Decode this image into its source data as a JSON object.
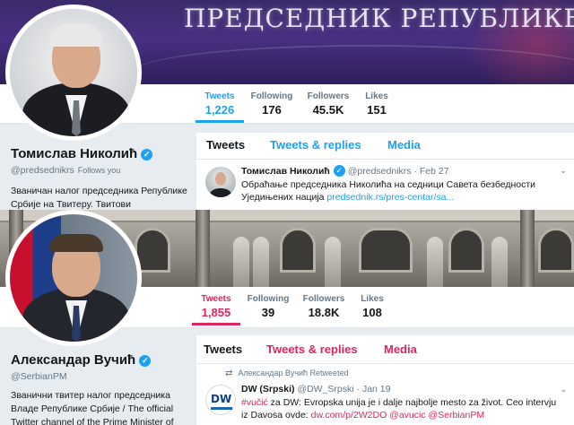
{
  "profile1": {
    "banner_text": "ПРЕДСЕДНИК РЕПУБЛИКЕ СРБИЈЕ",
    "nav": [
      {
        "label": "Tweets",
        "value": "1,226"
      },
      {
        "label": "Following",
        "value": "176"
      },
      {
        "label": "Followers",
        "value": "45.5K"
      },
      {
        "label": "Likes",
        "value": "151"
      }
    ],
    "name": "Томислав Николић",
    "handle": "@predsednikrs",
    "follows_you": "Follows you",
    "bio": "Званичан налог председника Републике Србије на Твитеру. Твитови",
    "tabs": [
      "Tweets",
      "Tweets & replies",
      "Media"
    ],
    "tweet": {
      "name": "Томислав Николић",
      "handle": "@predsednikrs",
      "date": "Feb 27",
      "text": "Обраћање председника Николића на седници Савета безбедности Уједињених нација",
      "link": "predsednik.rs/pres-centar/sa..."
    }
  },
  "profile2": {
    "nav": [
      {
        "label": "Tweets",
        "value": "1,855"
      },
      {
        "label": "Following",
        "value": "39"
      },
      {
        "label": "Followers",
        "value": "18.8K"
      },
      {
        "label": "Likes",
        "value": "108"
      }
    ],
    "name": "Александар Вучић",
    "handle": "@SerbianPM",
    "bio": "Званични твитер налог председника Владе Републике Србије / The official Twitter channel of the Prime Minister of",
    "tabs": [
      "Tweets",
      "Tweets & replies",
      "Media"
    ],
    "tweet": {
      "retweeted_by": "Александар Вучић Retweeted",
      "name": "DW (Srpski)",
      "handle": "@DW_Srpski",
      "date": "Jan 19",
      "hashtag": "#vučić",
      "text": " za DW: Evropska unija je i dalje najbolje mesto za život. Ceo intervju iz Davosa ovde: ",
      "link": "dw.com/p/2W2DO",
      "mention1": "@avucic",
      "mention2": "@SerbianPM",
      "logo_text": "DW"
    }
  },
  "colors": {
    "accent1": "#1da1f2",
    "accent2": "#e0245e"
  }
}
